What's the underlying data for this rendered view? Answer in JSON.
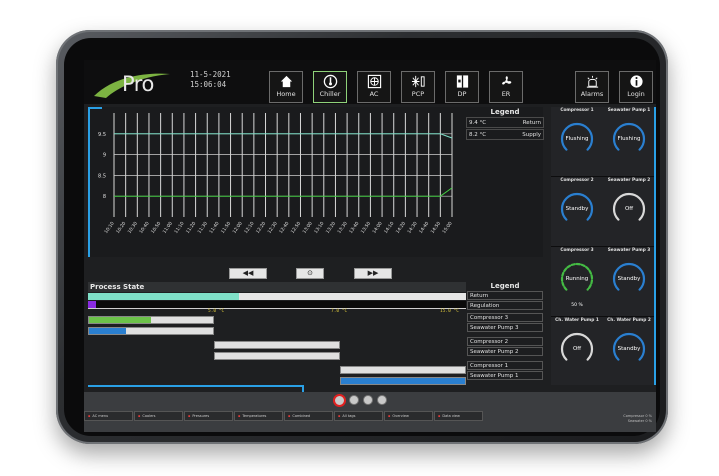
{
  "header": {
    "logo_text": "Pro",
    "date": "11-5-2021",
    "time": "15:06:04",
    "nav": [
      {
        "label": "Home",
        "icon": "home-icon"
      },
      {
        "label": "Chiller",
        "icon": "thermometer-icon",
        "active": true
      },
      {
        "label": "AC",
        "icon": "fan-box-icon"
      },
      {
        "label": "PCP",
        "icon": "snowflake-gauge-icon"
      },
      {
        "label": "DP",
        "icon": "panel-icon"
      },
      {
        "label": "ER",
        "icon": "fan-icon"
      },
      {
        "label": "Alarms",
        "icon": "alarm-icon"
      },
      {
        "label": "Login",
        "icon": "info-icon"
      }
    ]
  },
  "chart_data": {
    "type": "line",
    "title": "",
    "xlabel": "",
    "ylabel": "",
    "ylim": [
      7.5,
      10.0
    ],
    "y_ticks": [
      "9.5",
      "9",
      "8.5",
      "8"
    ],
    "x": [
      "15:01:10",
      "15:01:20",
      "15:01:30",
      "15:01:40",
      "15:01:50",
      "15:02:00",
      "15:02:10",
      "15:02:20",
      "15:02:30",
      "15:02:40",
      "15:02:50",
      "15:03:00",
      "15:03:10",
      "15:03:20",
      "15:03:30",
      "15:03:40",
      "15:03:50",
      "15:04:00",
      "15:04:10",
      "15:04:20",
      "15:04:30",
      "15:04:40",
      "15:04:50",
      "15:05:00",
      "15:05:10",
      "15:05:20",
      "15:05:30",
      "15:05:40",
      "15:05:50",
      "15:06:00"
    ],
    "x_tick_labels": [
      "10:10",
      "10:20",
      "10:30",
      "10:40",
      "10:50",
      "11:00",
      "11:10",
      "11:20",
      "11:30",
      "11:40",
      "11:50",
      "12:00",
      "12:10",
      "12:20",
      "12:30",
      "12:40",
      "12:50",
      "13:00",
      "13:10",
      "13:20",
      "13:30",
      "13:40",
      "13:50",
      "14:00",
      "14:10",
      "14:20",
      "14:30",
      "14:40",
      "14:50",
      "15:00"
    ],
    "series": [
      {
        "name": "Return",
        "color": "#7fe0c8",
        "values": [
          9.5,
          9.5,
          9.5,
          9.5,
          9.5,
          9.5,
          9.5,
          9.5,
          9.5,
          9.5,
          9.5,
          9.5,
          9.5,
          9.5,
          9.5,
          9.5,
          9.5,
          9.5,
          9.5,
          9.5,
          9.5,
          9.5,
          9.5,
          9.5,
          9.5,
          9.5,
          9.5,
          9.5,
          9.5,
          9.4
        ]
      },
      {
        "name": "Supply",
        "color": "#44cc44",
        "values": [
          8.0,
          8.0,
          8.0,
          8.0,
          8.0,
          8.0,
          8.0,
          8.0,
          8.0,
          8.0,
          8.0,
          8.0,
          8.0,
          8.0,
          8.0,
          8.0,
          8.0,
          8.0,
          8.0,
          8.0,
          8.0,
          8.0,
          8.0,
          8.0,
          8.0,
          8.0,
          8.0,
          8.0,
          8.0,
          8.2
        ]
      }
    ],
    "grid": true,
    "legend": "right"
  },
  "legend1": {
    "title": "Legend",
    "rows": [
      {
        "value": "9.4 °C",
        "name": "Return"
      },
      {
        "value": "8.2 °C",
        "name": "Supply"
      }
    ]
  },
  "chart_controls": {
    "prev": "◀◀",
    "center": "⊙",
    "next": "▶▶"
  },
  "process": {
    "title": "Process State",
    "scale": [
      "5.0 °C",
      "7.0 °C",
      "15.0 °C"
    ],
    "return_fraction": 0.4,
    "regulation_fraction": 0.02,
    "bars": [
      {
        "row": "compressor-3",
        "fill": 0.5,
        "color": "#6cc24a"
      },
      {
        "row": "seawater-pump-3",
        "fill": 0.3,
        "color": "#2a7fd0"
      },
      {
        "row": "compressor-2",
        "fill": 0.0,
        "color": "#6cc24a"
      },
      {
        "row": "seawater-pump-2",
        "fill": 0.0,
        "color": "#2a7fd0"
      },
      {
        "row": "compressor-1",
        "fill": 0.0,
        "color": "#6cc24a"
      },
      {
        "row": "seawater-pump-1",
        "fill": 1.0,
        "color": "#2a7fd0"
      }
    ]
  },
  "legend2": {
    "title": "Legend",
    "rows": [
      "Return",
      "Regulation",
      "Compressor 3",
      "Seawater Pump 3",
      "Compressor 2",
      "Seawater Pump 2",
      "Compressor 1",
      "Seawater Pump 1"
    ]
  },
  "gauges": [
    {
      "title": "Compressor 1",
      "status": "Flushing",
      "color": "#2a7fd0"
    },
    {
      "title": "Seawater Pump 1",
      "status": "Flushing",
      "color": "#2a7fd0"
    },
    {
      "title": "Compressor 2",
      "status": "Standby",
      "color": "#2a7fd0"
    },
    {
      "title": "Seawater Pump 2",
      "status": "Off",
      "color": "#d8d8d8"
    },
    {
      "title": "Compressor 3",
      "status": "Running",
      "sub": "50 %",
      "color": "#44bb44"
    },
    {
      "title": "Seawater Pump 3",
      "status": "Standby",
      "color": "#2a7fd0"
    },
    {
      "title": "Ch. Water Pump 1",
      "status": "Off",
      "color": "#d8d8d8"
    },
    {
      "title": "Ch. Water Pump 2",
      "status": "Standby",
      "color": "#2a7fd0"
    }
  ],
  "footer": {
    "tabs": [
      "AC menu",
      "Coolers",
      "Pressures",
      "Temperatures",
      "Combined",
      "All tags",
      "Overview",
      "Data view"
    ],
    "right_text": [
      "Compressor  0 %",
      "Seawater    0 %"
    ]
  },
  "colors": {
    "accent_blue": "#2aa0e6",
    "active_green": "#8fd27a",
    "alarm_red": "#e02020"
  }
}
